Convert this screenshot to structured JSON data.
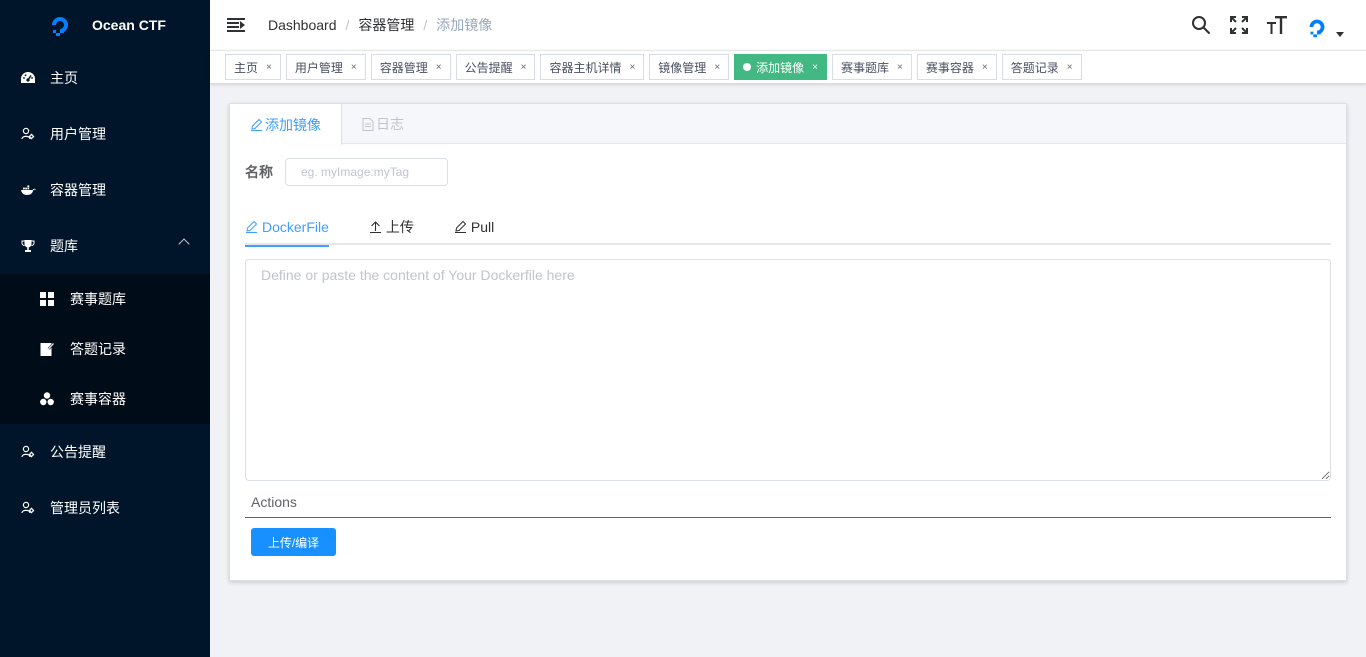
{
  "app": {
    "title": "Ocean CTF"
  },
  "sidebar": {
    "items": [
      {
        "label": "主页",
        "icon": "dashboard-icon"
      },
      {
        "label": "用户管理",
        "icon": "user-icon"
      },
      {
        "label": "容器管理",
        "icon": "docker-icon"
      },
      {
        "label": "题库",
        "icon": "trophy-icon",
        "expanded": true,
        "children": [
          {
            "label": "赛事题库",
            "icon": "grid-icon"
          },
          {
            "label": "答题记录",
            "icon": "edit-doc-icon"
          },
          {
            "label": "赛事容器",
            "icon": "cluster-icon"
          }
        ]
      },
      {
        "label": "公告提醒",
        "icon": "user-icon"
      },
      {
        "label": "管理员列表",
        "icon": "user-icon"
      }
    ]
  },
  "header": {
    "breadcrumb": [
      "Dashboard",
      "容器管理",
      "添加镜像"
    ]
  },
  "tags": [
    {
      "label": "主页",
      "active": false
    },
    {
      "label": "用户管理",
      "active": false
    },
    {
      "label": "容器管理",
      "active": false
    },
    {
      "label": "公告提醒",
      "active": false
    },
    {
      "label": "容器主机详情",
      "active": false
    },
    {
      "label": "镜像管理",
      "active": false
    },
    {
      "label": "添加镜像",
      "active": true
    },
    {
      "label": "赛事题库",
      "active": false
    },
    {
      "label": "赛事容器",
      "active": false
    },
    {
      "label": "答题记录",
      "active": false
    }
  ],
  "tag_close": "×",
  "card": {
    "tabs": [
      {
        "label": "添加镜像",
        "active": true
      },
      {
        "label": "日志",
        "active": false
      }
    ],
    "name_label": "名称",
    "name_placeholder": "eg. myImage:myTag",
    "inner_tabs": [
      {
        "label": "DockerFile",
        "active": true
      },
      {
        "label": "上传",
        "active": false
      },
      {
        "label": "Pull",
        "active": false
      }
    ],
    "dockerfile_placeholder": "Define or paste the content of Your Dockerfile here",
    "actions_label": "Actions",
    "upload_button": "上传/编译"
  },
  "colors": {
    "sidebar_bg": "#001529",
    "active_tag": "#42b983",
    "primary": "#409eff",
    "button": "#1890ff"
  }
}
